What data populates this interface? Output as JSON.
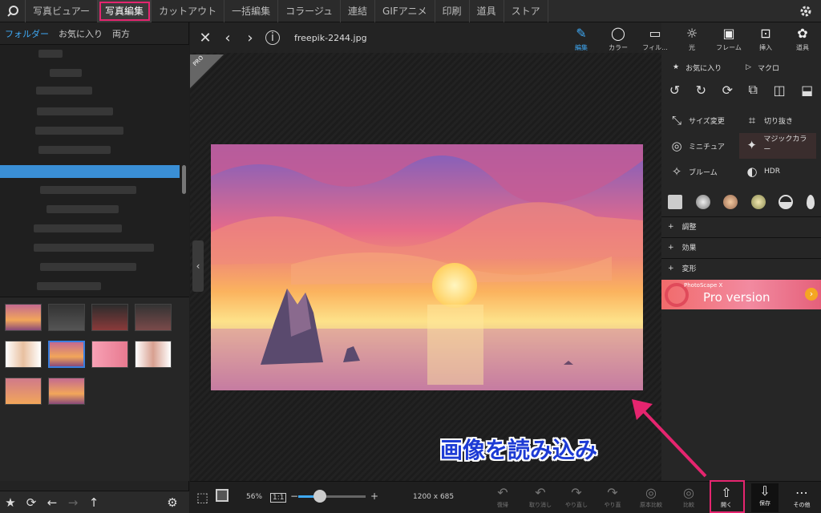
{
  "topbar": {
    "tabs": [
      "写真ビュアー",
      "写真編集",
      "カットアウト",
      "一括編集",
      "コラージュ",
      "連結",
      "GIFアニメ",
      "印刷",
      "道具",
      "ストア"
    ],
    "active_tab": "写真編集"
  },
  "left": {
    "tabs": [
      "フォルダー",
      "お気に入り",
      "両方"
    ],
    "active_tab": "フォルダー"
  },
  "viewer": {
    "filename": "freepik-2244.jpg",
    "pro_badge": "PRO",
    "dimensions": "1200 x 685",
    "zoom": "56%",
    "zoom_1to1": "1:1",
    "zoom_level": 0.32
  },
  "right": {
    "tools": [
      {
        "label": "編集",
        "icon": "edit-icon",
        "active": true
      },
      {
        "label": "カラー",
        "icon": "color-icon"
      },
      {
        "label": "フィル...",
        "icon": "film-icon"
      },
      {
        "label": "光",
        "icon": "sun-icon"
      },
      {
        "label": "フレーム",
        "icon": "frame-icon"
      },
      {
        "label": "挿入",
        "icon": "insert-icon"
      },
      {
        "label": "道具",
        "icon": "palette-icon"
      }
    ],
    "favorites": "お気に入り",
    "macro": "マクロ",
    "features": {
      "resize": "サイズ変更",
      "crop": "切り抜き",
      "miniature": "ミニチュア",
      "magic_color": "マジックカラー",
      "bloom": "ブルーム",
      "hdr": "HDR"
    },
    "accordions": [
      "調整",
      "効果",
      "変形"
    ],
    "promo_small": "PhotoScape X",
    "promo_big": "Pro version"
  },
  "bottom": {
    "items": [
      "復帰",
      "取り消し",
      "やり直し",
      "やり直",
      "原本比較",
      "比較",
      "開く",
      "保存",
      "その他"
    ]
  },
  "annotation": {
    "text": "画像を読み込み",
    "color": "#1d3bd4",
    "highlight_color": "#e5256f"
  }
}
